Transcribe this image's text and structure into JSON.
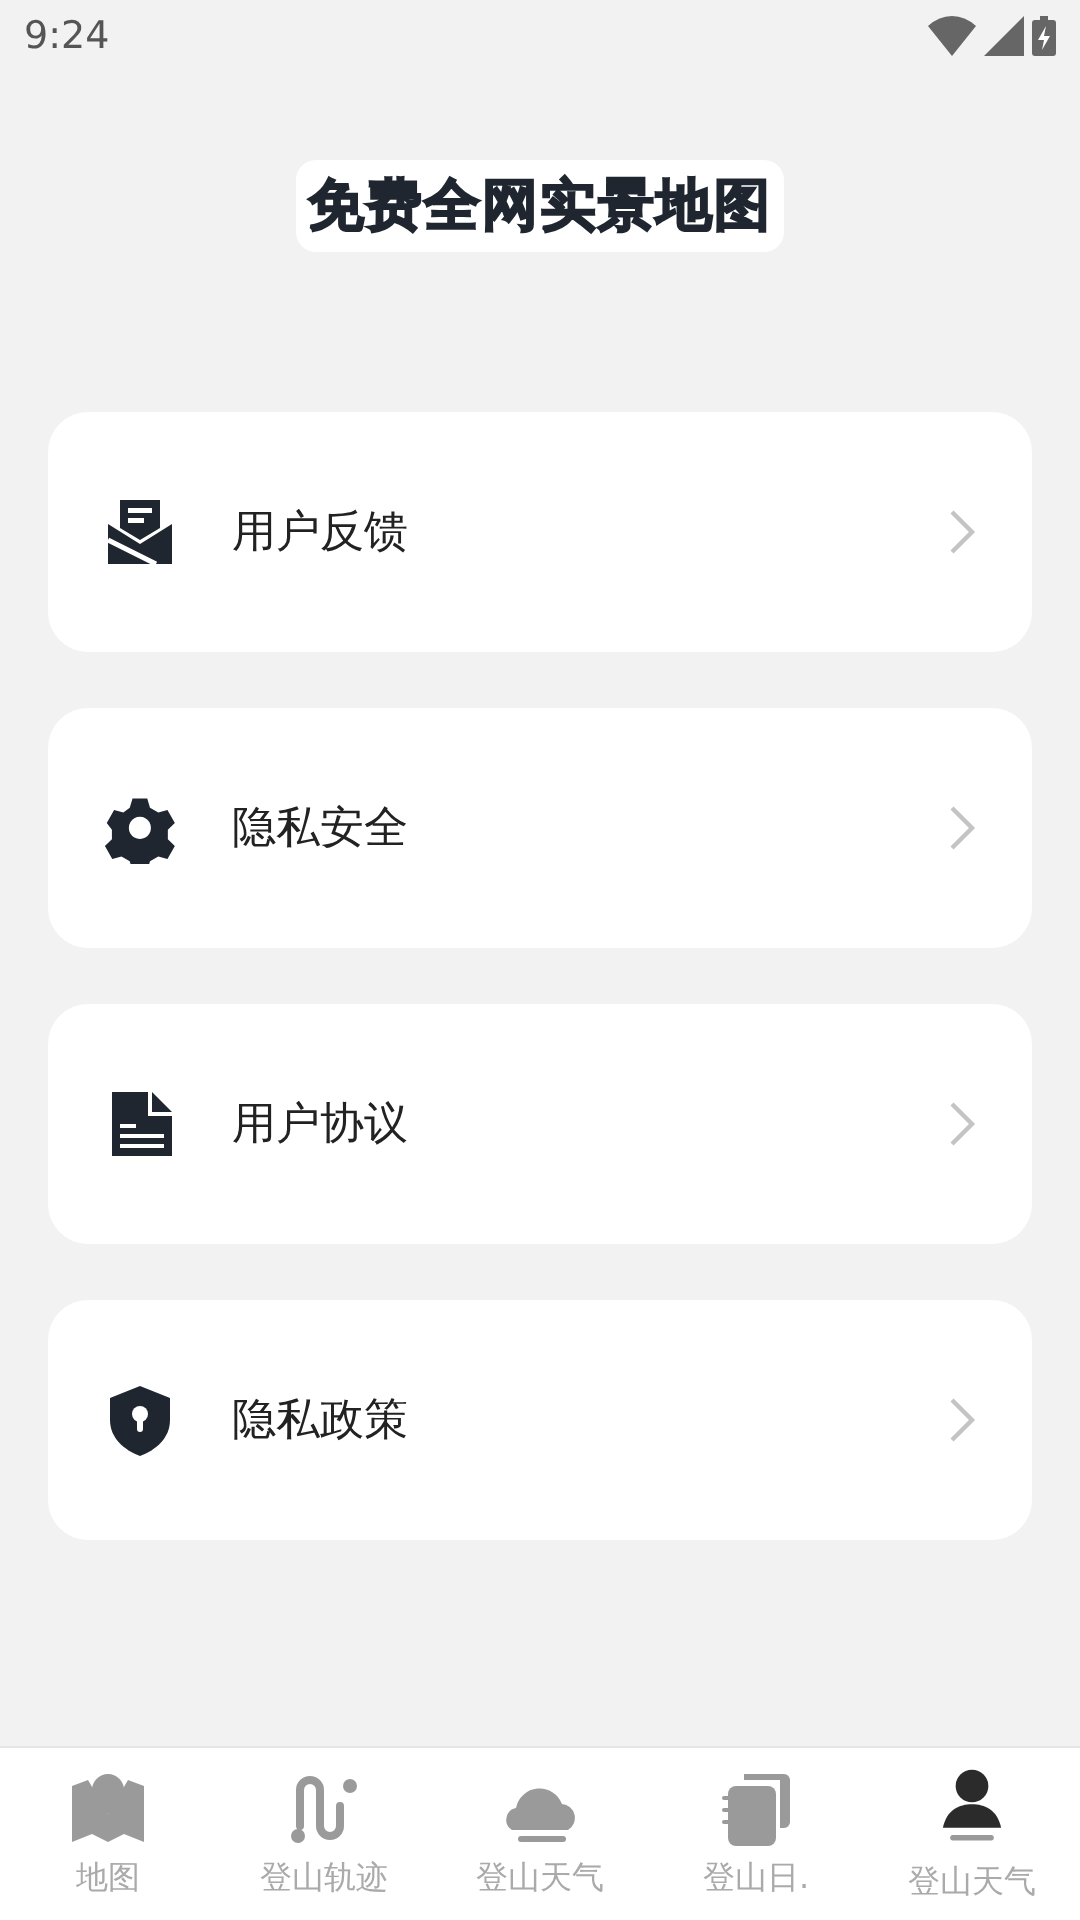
{
  "status_bar": {
    "time": "9:24"
  },
  "title": "免费全网实景地图",
  "menu": [
    {
      "kind": "mail",
      "label": "用户反馈"
    },
    {
      "kind": "gear",
      "label": "隐私安全"
    },
    {
      "kind": "document",
      "label": "用户协议"
    },
    {
      "kind": "shield",
      "label": "隐私政策"
    }
  ],
  "tabs": [
    {
      "kind": "map",
      "label": "地图",
      "selected": false
    },
    {
      "kind": "track",
      "label": "登山轨迹",
      "selected": false
    },
    {
      "kind": "cloud",
      "label": "登山天气",
      "selected": false
    },
    {
      "kind": "notebook",
      "label": "登山日.",
      "selected": false
    },
    {
      "kind": "person",
      "label": "登山天气",
      "selected": true
    }
  ]
}
